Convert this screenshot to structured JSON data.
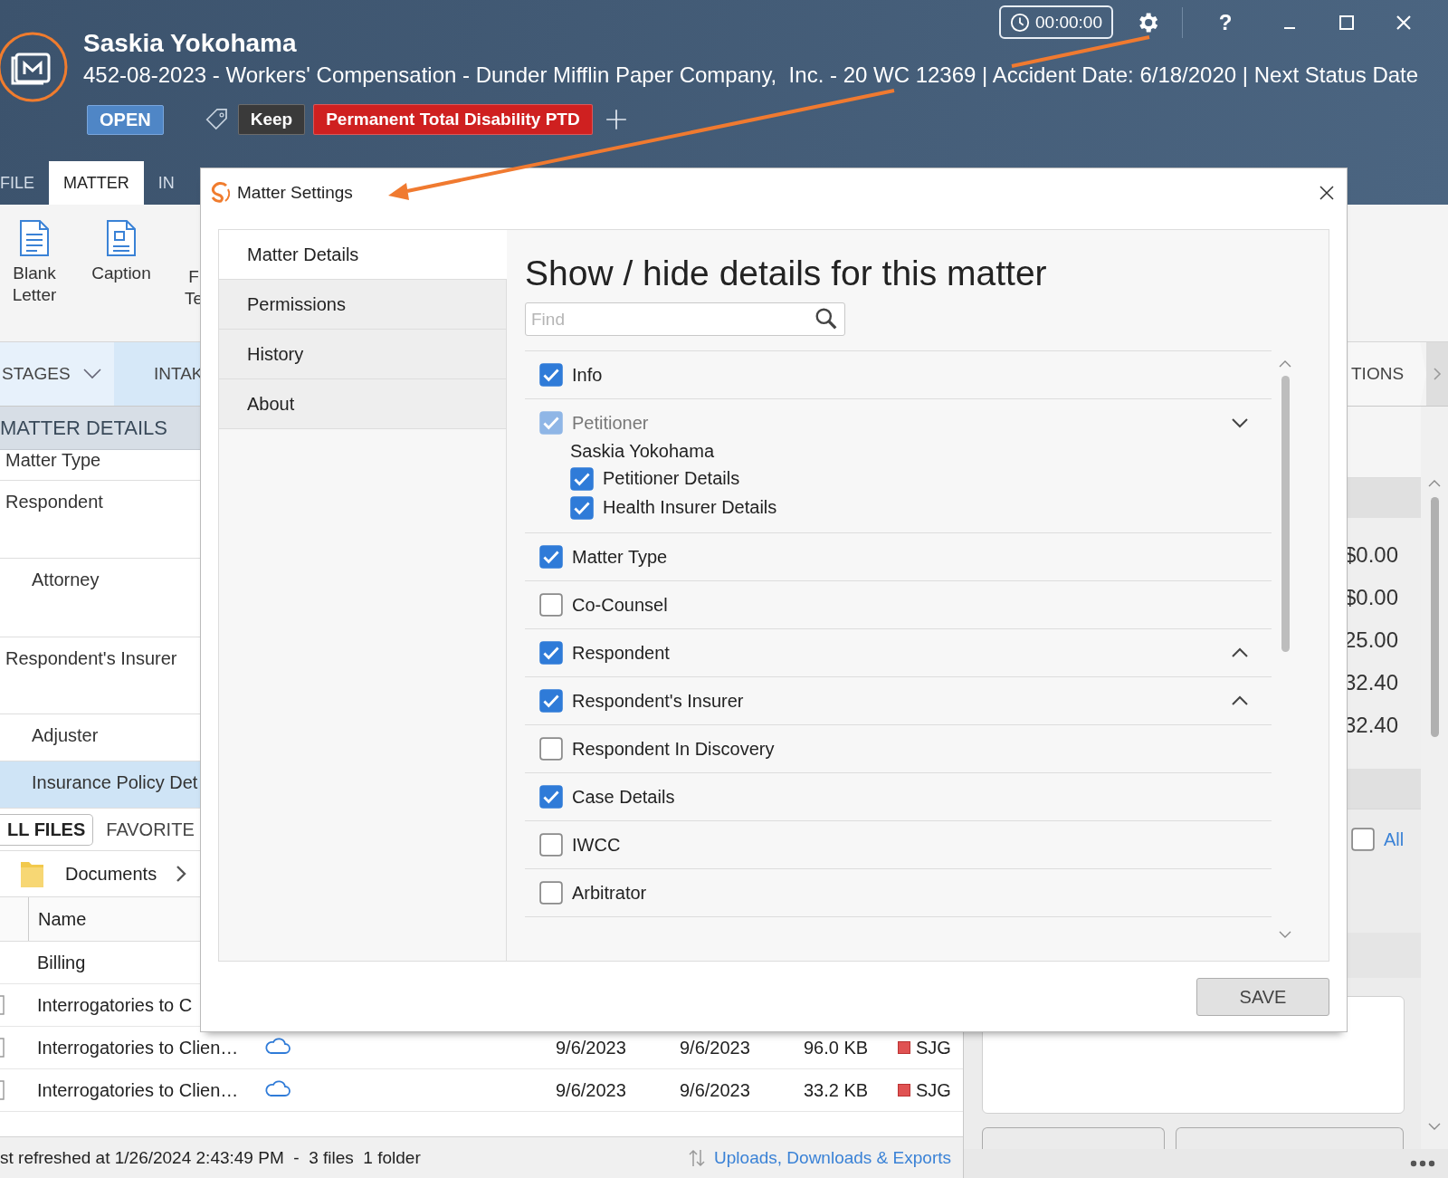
{
  "header": {
    "title": "Saskia Yokohama",
    "subtitle": "452-08-2023 - Workers' Compensation - Dunder Mifflin Paper Company,  Inc. - 20 WC 12369 | Accident Date: 6/18/2020 | Next Status Date",
    "status": "OPEN",
    "tags": [
      {
        "label": "Keep",
        "color": "#3a3a3a"
      },
      {
        "label": "Permanent Total Disability PTD",
        "color": "#cf2020"
      }
    ],
    "timer": "00:00:00",
    "help": "?"
  },
  "tabs": [
    {
      "label": "FILE",
      "selected": false
    },
    {
      "label": "MATTER",
      "selected": true
    },
    {
      "label": "IN",
      "selected": false
    }
  ],
  "ribbon": [
    {
      "kind": "letter",
      "lines": [
        "Blank",
        "Letter"
      ]
    },
    {
      "kind": "caption",
      "lines": [
        "Caption"
      ]
    },
    {
      "kind": "plain",
      "lines": [
        "F",
        "Te"
      ]
    }
  ],
  "stages": {
    "menu": "STAGES",
    "tabs": [
      {
        "label": "INTAK",
        "selected": true
      },
      {
        "label": "TIONS",
        "selected": false
      }
    ]
  },
  "matter_details": {
    "title": "MATTER DETAILS",
    "rows": [
      {
        "label": "Matter Type",
        "selected": false
      },
      {
        "label": "Respondent",
        "selected": false,
        "children": [
          {
            "label": "Attorney",
            "selected": false
          }
        ]
      },
      {
        "label": "Respondent's Insurer",
        "selected": false,
        "children": [
          {
            "label": "Adjuster",
            "selected": false
          },
          {
            "label": "Insurance Policy Det",
            "selected": true
          }
        ]
      }
    ]
  },
  "files": {
    "tabs": [
      {
        "label": "LL FILES",
        "selected": true
      },
      {
        "label": "FAVORITE",
        "selected": false
      }
    ],
    "breadcrumb": "Documents",
    "columns": [
      "Name"
    ],
    "rows": [
      {
        "kind": "folder",
        "name": "Billing"
      },
      {
        "kind": "file",
        "name": "Interrogatories to C"
      },
      {
        "kind": "file",
        "name": "Interrogatories to Clien…",
        "cloud": true,
        "column_2": "9/6/2023",
        "column_3": "9/6/2023",
        "column_4": "96.0 KB",
        "owner": "SJG",
        "color": "#e05252"
      },
      {
        "kind": "file",
        "name": "Interrogatories to Clien…",
        "cloud": true,
        "column_2": "9/6/2023",
        "column_3": "9/6/2023",
        "column_4": "33.2 KB",
        "owner": "SJG",
        "color": "#e05252"
      }
    ]
  },
  "status_bar": {
    "text": "st refreshed at 1/26/2024 2:43:49 PM  -  3 files  1 folder",
    "link": "Uploads, Downloads & Exports"
  },
  "right_panel": {
    "amounts": [
      "$0.00",
      "$0.00",
      "25.00",
      "32.40",
      "32.40"
    ],
    "all": {
      "label": "All",
      "checked": false
    }
  },
  "dialog": {
    "title": "Matter Settings",
    "nav": [
      {
        "label": "Matter Details",
        "selected": true
      },
      {
        "label": "Permissions",
        "selected": false
      },
      {
        "label": "History",
        "selected": false
      },
      {
        "label": "About",
        "selected": false
      }
    ],
    "heading": "Show / hide details for this matter",
    "search": {
      "placeholder": "Find"
    },
    "items": [
      {
        "label": "Info",
        "checked": true,
        "disabled": false
      },
      {
        "label": "Petitioner",
        "checked": true,
        "disabled": true,
        "expanded": true,
        "group": "Saskia Yokohama",
        "children": [
          {
            "label": "Petitioner Details",
            "checked": true,
            "disabled": false
          },
          {
            "label": "Health Insurer Details",
            "checked": true,
            "disabled": false
          }
        ]
      },
      {
        "label": "Matter Type",
        "checked": true,
        "disabled": false
      },
      {
        "label": "Co-Counsel",
        "checked": false,
        "disabled": false
      },
      {
        "label": "Respondent",
        "checked": true,
        "disabled": false,
        "expanded": false
      },
      {
        "label": "Respondent's Insurer",
        "checked": true,
        "disabled": false,
        "expanded": false
      },
      {
        "label": "Respondent In Discovery",
        "checked": false,
        "disabled": false
      },
      {
        "label": "Case Details",
        "checked": true,
        "disabled": false
      },
      {
        "label": "IWCC",
        "checked": false,
        "disabled": false
      },
      {
        "label": "Arbitrator",
        "checked": false,
        "disabled": false
      }
    ],
    "save": "SAVE"
  }
}
